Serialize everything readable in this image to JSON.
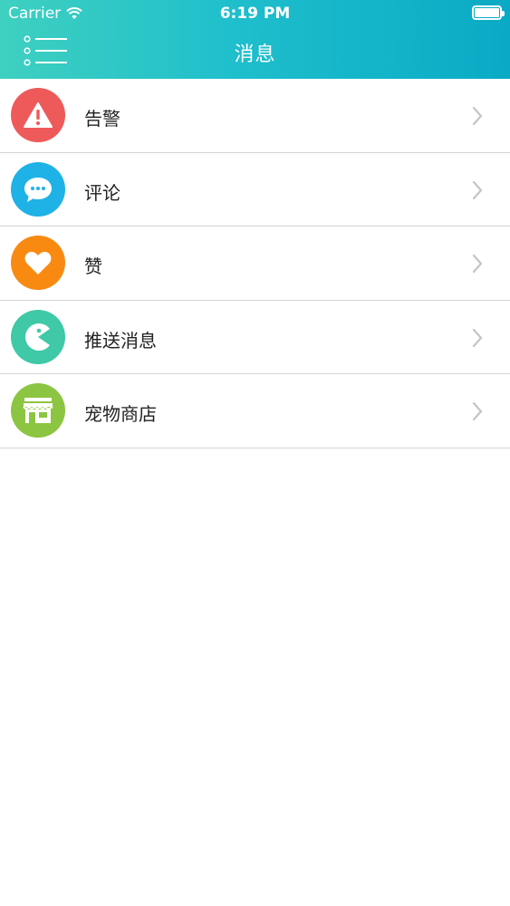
{
  "status_bar": {
    "carrier": "Carrier",
    "time": "6:19 PM"
  },
  "header": {
    "title": "消息",
    "menu_icon": "list-menu-icon",
    "gradient_colors": [
      "#3fd0c0",
      "#0aaac6"
    ]
  },
  "items": [
    {
      "label": "告警",
      "icon": "warning-icon",
      "color": "#ee5a5a"
    },
    {
      "label": "评论",
      "icon": "comment-icon",
      "color": "#1fb2e6"
    },
    {
      "label": "赞",
      "icon": "heart-icon",
      "color": "#f88a12"
    },
    {
      "label": "推送消息",
      "icon": "push-message-icon",
      "color": "#3fc9a6"
    },
    {
      "label": "宠物商店",
      "icon": "pet-store-icon",
      "color": "#8cc541"
    }
  ]
}
